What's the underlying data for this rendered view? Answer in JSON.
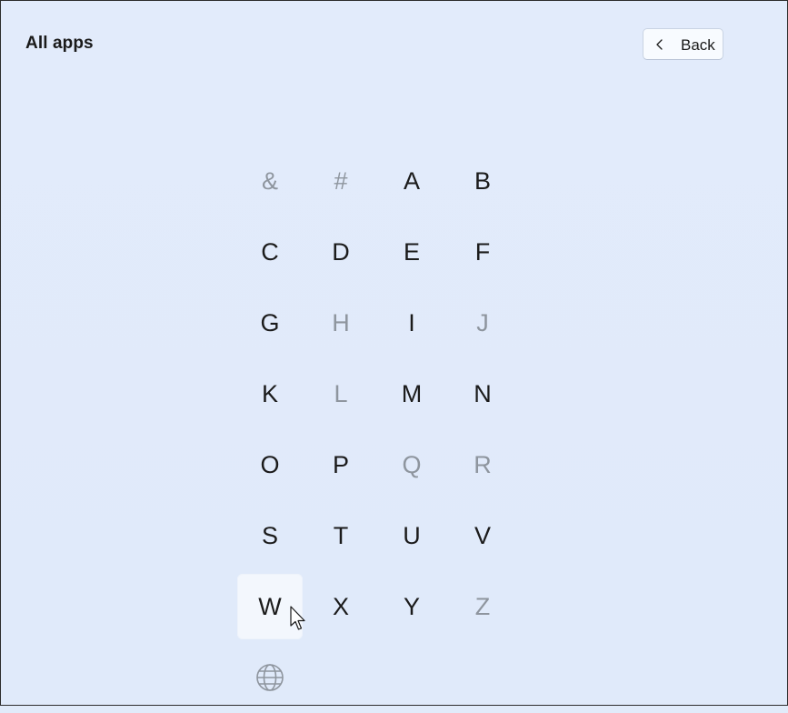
{
  "header": {
    "title": "All apps",
    "back_label": "Back"
  },
  "letters": [
    {
      "label": "&",
      "enabled": false
    },
    {
      "label": "#",
      "enabled": false
    },
    {
      "label": "A",
      "enabled": true
    },
    {
      "label": "B",
      "enabled": true
    },
    {
      "label": "C",
      "enabled": true
    },
    {
      "label": "D",
      "enabled": true
    },
    {
      "label": "E",
      "enabled": true
    },
    {
      "label": "F",
      "enabled": true
    },
    {
      "label": "G",
      "enabled": true
    },
    {
      "label": "H",
      "enabled": false
    },
    {
      "label": "I",
      "enabled": true
    },
    {
      "label": "J",
      "enabled": false
    },
    {
      "label": "K",
      "enabled": true
    },
    {
      "label": "L",
      "enabled": false
    },
    {
      "label": "M",
      "enabled": true
    },
    {
      "label": "N",
      "enabled": true
    },
    {
      "label": "O",
      "enabled": true
    },
    {
      "label": "P",
      "enabled": true
    },
    {
      "label": "Q",
      "enabled": false
    },
    {
      "label": "R",
      "enabled": false
    },
    {
      "label": "S",
      "enabled": true
    },
    {
      "label": "T",
      "enabled": true
    },
    {
      "label": "U",
      "enabled": true
    },
    {
      "label": "V",
      "enabled": true
    },
    {
      "label": "W",
      "enabled": true,
      "hovered": true
    },
    {
      "label": "X",
      "enabled": true
    },
    {
      "label": "Y",
      "enabled": true
    },
    {
      "label": "Z",
      "enabled": false
    }
  ],
  "extra_items": [
    {
      "icon": "globe-icon",
      "enabled": false
    }
  ],
  "colors": {
    "background": "#e1ebfa",
    "text": "#1b1b1b",
    "disabled_text": "#8e959e",
    "hover_background": "#f3f7fd"
  }
}
